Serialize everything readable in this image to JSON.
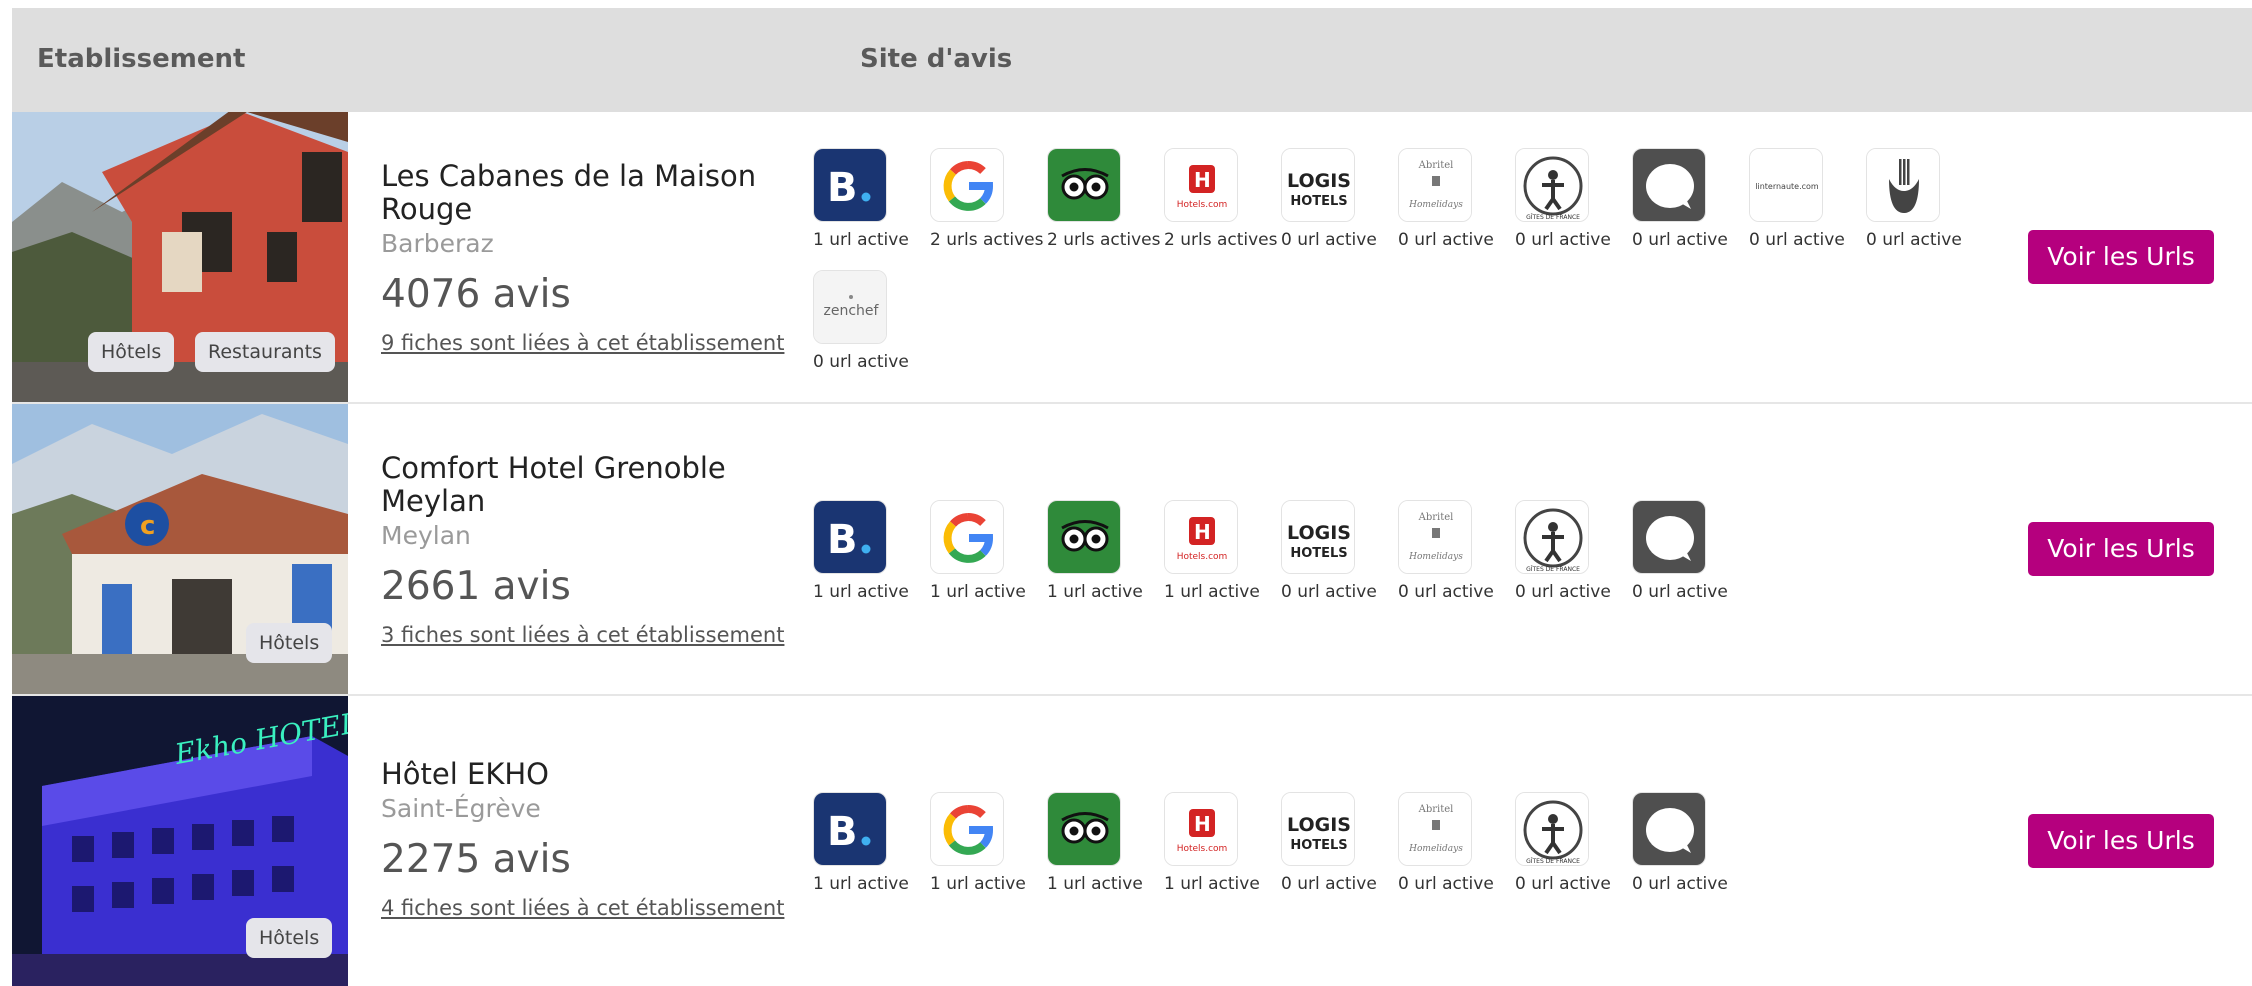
{
  "table": {
    "col_establishment": "Etablissement",
    "col_sites": "Site d'avis"
  },
  "rows": [
    {
      "name": "Les Cabanes de la Maison Rouge",
      "city": "Barberaz",
      "reviews": "4076 avis",
      "linked": "9 fiches sont liées à cet établissement",
      "tags": [
        "Hôtels",
        "Restaurants"
      ],
      "sites": [
        {
          "icon": "booking-icon",
          "label": "1 url active"
        },
        {
          "icon": "google-icon",
          "label": "2 urls actives"
        },
        {
          "icon": "tripadvisor-icon",
          "label": "2 urls actives"
        },
        {
          "icon": "hotels-com-icon",
          "label": "2 urls actives"
        },
        {
          "icon": "logis-hotels-icon",
          "label": "0 url active"
        },
        {
          "icon": "abritel-homelidays-icon",
          "label": "0 url active"
        },
        {
          "icon": "gites-de-france-icon",
          "label": "0 url active"
        },
        {
          "icon": "speech-bubble-icon",
          "label": "0 url active"
        },
        {
          "icon": "linternaute-icon",
          "label": "0 url active"
        },
        {
          "icon": "thefork-icon",
          "label": "0 url active"
        },
        {
          "icon": "zenchef-icon",
          "label": "0 url active"
        }
      ],
      "button": "Voir les Urls"
    },
    {
      "name": "Comfort Hotel Grenoble Meylan",
      "city": "Meylan",
      "reviews": "2661 avis",
      "linked": "3 fiches sont liées à cet établissement",
      "tags": [
        "Hôtels"
      ],
      "sites": [
        {
          "icon": "booking-icon",
          "label": "1 url active"
        },
        {
          "icon": "google-icon",
          "label": "1 url active"
        },
        {
          "icon": "tripadvisor-icon",
          "label": "1 url active"
        },
        {
          "icon": "hotels-com-icon",
          "label": "1 url active"
        },
        {
          "icon": "logis-hotels-icon",
          "label": "0 url active"
        },
        {
          "icon": "abritel-homelidays-icon",
          "label": "0 url active"
        },
        {
          "icon": "gites-de-france-icon",
          "label": "0 url active"
        },
        {
          "icon": "speech-bubble-icon",
          "label": "0 url active"
        }
      ],
      "button": "Voir les Urls"
    },
    {
      "name": "Hôtel EKHO",
      "city": "Saint-Égrève",
      "reviews": "2275 avis",
      "linked": "4 fiches sont liées à cet établissement",
      "tags": [
        "Hôtels"
      ],
      "sites": [
        {
          "icon": "booking-icon",
          "label": "1 url active"
        },
        {
          "icon": "google-icon",
          "label": "1 url active"
        },
        {
          "icon": "tripadvisor-icon",
          "label": "1 url active"
        },
        {
          "icon": "hotels-com-icon",
          "label": "1 url active"
        },
        {
          "icon": "logis-hotels-icon",
          "label": "0 url active"
        },
        {
          "icon": "abritel-homelidays-icon",
          "label": "0 url active"
        },
        {
          "icon": "gites-de-france-icon",
          "label": "0 url active"
        },
        {
          "icon": "speech-bubble-icon",
          "label": "0 url active"
        }
      ],
      "button": "Voir les Urls"
    }
  ],
  "logos": {
    "booking": "B.",
    "hotels_com": "Hotels.com",
    "logis_top": "LOGIS",
    "logis_bottom": "HOTELS",
    "abritel": "Abritel",
    "homelidays": "Homelidays",
    "gites": "GÎTES DE FRANCE",
    "linternaute": "linternaute.com",
    "zenchef": "zenchef",
    "ekho_sign": "Ekho HOTEL"
  },
  "colors": {
    "header_bg": "#dedede",
    "button_bg": "#b5007e",
    "booking": "#1a3572",
    "tripadvisor": "#2f8a3a",
    "bubble": "#4f4f4f"
  }
}
